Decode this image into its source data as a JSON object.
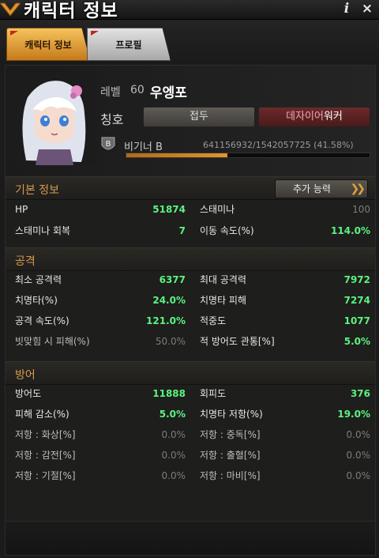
{
  "window": {
    "title": "캐릭터 정보",
    "info_glyph": "i",
    "close_glyph": "×"
  },
  "tabs": [
    {
      "label": "캐릭터 정보",
      "active": true
    },
    {
      "label": "프로필",
      "active": false
    }
  ],
  "profile": {
    "level_label": "레벨",
    "level": "60",
    "name": "우엥포",
    "title_label": "칭호",
    "title_slot1": "접두",
    "title_slot2_a": "데자",
    "title_slot2_b": "이어",
    "title_slot2_c": "워커",
    "rank": "비기너 B",
    "exp_text": "641156932/1542057725 (41.58%)",
    "exp_fraction": 0.4158
  },
  "sections": {
    "basic": {
      "title": "기본 정보",
      "extra_button": "추가 능력",
      "rows": [
        {
          "l_label": "HP",
          "l_value": "51874",
          "r_label": "스태미나",
          "r_value": "100",
          "r_dim": true
        },
        {
          "l_label": "스태미나 회복",
          "l_value": "7",
          "r_label": "이동 속도(%)",
          "r_value": "114.0%"
        }
      ]
    },
    "attack": {
      "title": "공격",
      "rows": [
        {
          "l_label": "최소 공격력",
          "l_value": "6377",
          "r_label": "최대 공격력",
          "r_value": "7972"
        },
        {
          "l_label": "치명타(%)",
          "l_value": "24.0%",
          "r_label": "치명타 피해",
          "r_value": "7274"
        },
        {
          "l_label": "공격 속도(%)",
          "l_value": "121.0%",
          "r_label": "적중도",
          "r_value": "1077"
        },
        {
          "l_label": "빗맞힘 시 피해(%)",
          "l_value": "50.0%",
          "l_dim": true,
          "r_label": "적 방어도 관통[%]",
          "r_value": "5.0%"
        }
      ]
    },
    "defense": {
      "title": "방어",
      "rows": [
        {
          "l_label": "방어도",
          "l_value": "11888",
          "r_label": "회피도",
          "r_value": "376"
        },
        {
          "l_label": "피해 감소(%)",
          "l_value": "5.0%",
          "r_label": "치명타 저항(%)",
          "r_value": "19.0%"
        },
        {
          "l_label": "저항 : 화상[%]",
          "l_value": "0.0%",
          "l_dim": true,
          "r_label": "저항 : 중독[%]",
          "r_value": "0.0%",
          "r_dim": true
        },
        {
          "l_label": "저항 : 감전[%]",
          "l_value": "0.0%",
          "l_dim": true,
          "r_label": "저항 : 출혈[%]",
          "r_value": "0.0%",
          "r_dim": true
        },
        {
          "l_label": "저항 : 기절[%]",
          "l_value": "0.0%",
          "l_dim": true,
          "r_label": "저항 : 마비[%]",
          "r_value": "0.0%",
          "r_dim": true
        }
      ]
    }
  },
  "icons": {
    "title_emblem": "gold-chevron-emblem-icon",
    "info": "info-icon",
    "close": "close-icon",
    "rank_badge": "shield-badge-icon",
    "extra_chevron": "double-chevron-right-icon"
  },
  "colors": {
    "accent_gold": "#e0962c",
    "stat_green": "#5bf37f",
    "section_title": "#d49a4f",
    "dim_value": "#7b7b7b",
    "title_pink": "#f3a3b6"
  }
}
